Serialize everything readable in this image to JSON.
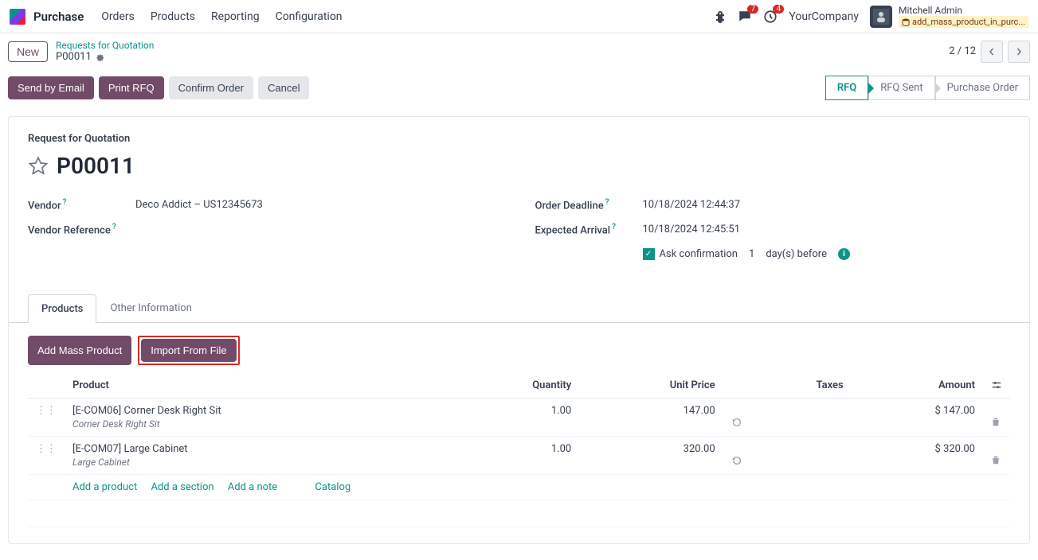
{
  "topbar": {
    "app_name": "Purchase",
    "nav": {
      "orders": "Orders",
      "products": "Products",
      "reporting": "Reporting",
      "configuration": "Configuration"
    },
    "chat_badge": "7",
    "activity_badge": "4",
    "company": "YourCompany",
    "user_name": "Mitchell Admin",
    "file_tag": "add_mass_product_in_purc..."
  },
  "breadcrumb": {
    "new_label": "New",
    "parent": "Requests for Quotation",
    "current": "P00011"
  },
  "pager": {
    "text": "2 / 12"
  },
  "actions": {
    "send_email": "Send by Email",
    "print_rfq": "Print RFQ",
    "confirm": "Confirm Order",
    "cancel": "Cancel"
  },
  "status": {
    "rfq": "RFQ",
    "rfq_sent": "RFQ Sent",
    "po": "Purchase Order"
  },
  "form": {
    "section": "Request for Quotation",
    "title": "P00011",
    "labels": {
      "vendor": "Vendor",
      "vendor_ref": "Vendor Reference",
      "deadline": "Order Deadline",
      "expected": "Expected Arrival",
      "ask_confirm": "Ask confirmation",
      "days_before": "day(s) before"
    },
    "values": {
      "vendor": "Deco Addict – US12345673",
      "deadline": "10/18/2024 12:44:37",
      "expected": "10/18/2024 12:45:51",
      "confirm_days": "1"
    }
  },
  "tabs": {
    "products": "Products",
    "other": "Other Information"
  },
  "table": {
    "actions": {
      "add_mass": "Add Mass Product",
      "import_file": "Import From File"
    },
    "headers": {
      "product": "Product",
      "quantity": "Quantity",
      "unit_price": "Unit Price",
      "taxes": "Taxes",
      "amount": "Amount"
    },
    "rows": [
      {
        "name": "[E-COM06] Corner Desk Right Sit",
        "desc": "Corner Desk Right Sit",
        "qty": "1.00",
        "price": "147.00",
        "amount": "$ 147.00"
      },
      {
        "name": "[E-COM07] Large Cabinet",
        "desc": "Large Cabinet",
        "qty": "1.00",
        "price": "320.00",
        "amount": "$ 320.00"
      }
    ],
    "add": {
      "product": "Add a product",
      "section": "Add a section",
      "note": "Add a note",
      "catalog": "Catalog"
    }
  }
}
